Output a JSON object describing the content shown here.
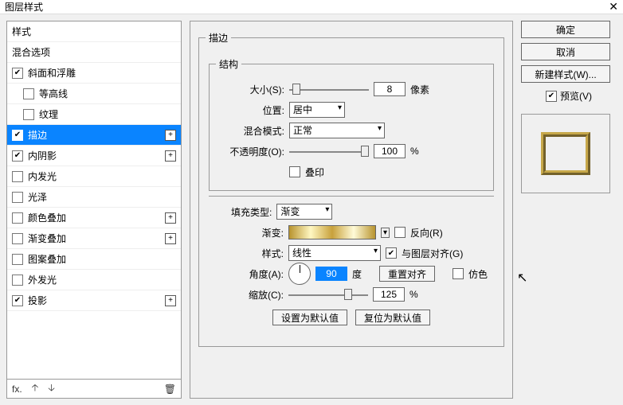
{
  "window": {
    "title": "图层样式",
    "close": "✕"
  },
  "sidebar": {
    "header1": "样式",
    "header2": "混合选项",
    "items": [
      {
        "label": "斜面和浮雕",
        "checked": true,
        "plus": false,
        "sub": false
      },
      {
        "label": "等高线",
        "checked": false,
        "plus": false,
        "sub": true
      },
      {
        "label": "纹理",
        "checked": false,
        "plus": false,
        "sub": true
      },
      {
        "label": "描边",
        "checked": true,
        "plus": true,
        "sub": false,
        "selected": true
      },
      {
        "label": "内阴影",
        "checked": true,
        "plus": true,
        "sub": false
      },
      {
        "label": "内发光",
        "checked": false,
        "plus": false,
        "sub": false
      },
      {
        "label": "光泽",
        "checked": false,
        "plus": false,
        "sub": false
      },
      {
        "label": "颜色叠加",
        "checked": false,
        "plus": true,
        "sub": false
      },
      {
        "label": "渐变叠加",
        "checked": false,
        "plus": true,
        "sub": false
      },
      {
        "label": "图案叠加",
        "checked": false,
        "plus": false,
        "sub": false
      },
      {
        "label": "外发光",
        "checked": false,
        "plus": false,
        "sub": false
      },
      {
        "label": "投影",
        "checked": true,
        "plus": true,
        "sub": false
      }
    ],
    "footer": {
      "fx": "fx.",
      "up": "🡡",
      "down": "🡣",
      "trash": "🗑"
    }
  },
  "stroke": {
    "legend_outer": "描边",
    "legend_struct": "结构",
    "size_label": "大小(S):",
    "size_value": "8",
    "size_unit": "像素",
    "pos_label": "位置:",
    "pos_value": "居中",
    "blend_label": "混合模式:",
    "blend_value": "正常",
    "opacity_label": "不透明度(O):",
    "opacity_value": "100",
    "opacity_unit": "%",
    "overprint_label": "叠印",
    "fill_type_label": "填充类型:",
    "fill_type_value": "渐变",
    "gradient_label": "渐变:",
    "reverse_label": "反向(R)",
    "style_label": "样式:",
    "style_value": "线性",
    "align_label": "与图层对齐(G)",
    "angle_label": "角度(A):",
    "angle_value": "90",
    "angle_unit": "度",
    "reset_align": "重置对齐",
    "dither_label": "仿色",
    "scale_label": "缩放(C):",
    "scale_value": "125",
    "scale_unit": "%",
    "set_default": "设置为默认值",
    "reset_default": "复位为默认值"
  },
  "right": {
    "ok": "确定",
    "cancel": "取消",
    "new_style": "新建样式(W)...",
    "preview": "预览(V)"
  }
}
